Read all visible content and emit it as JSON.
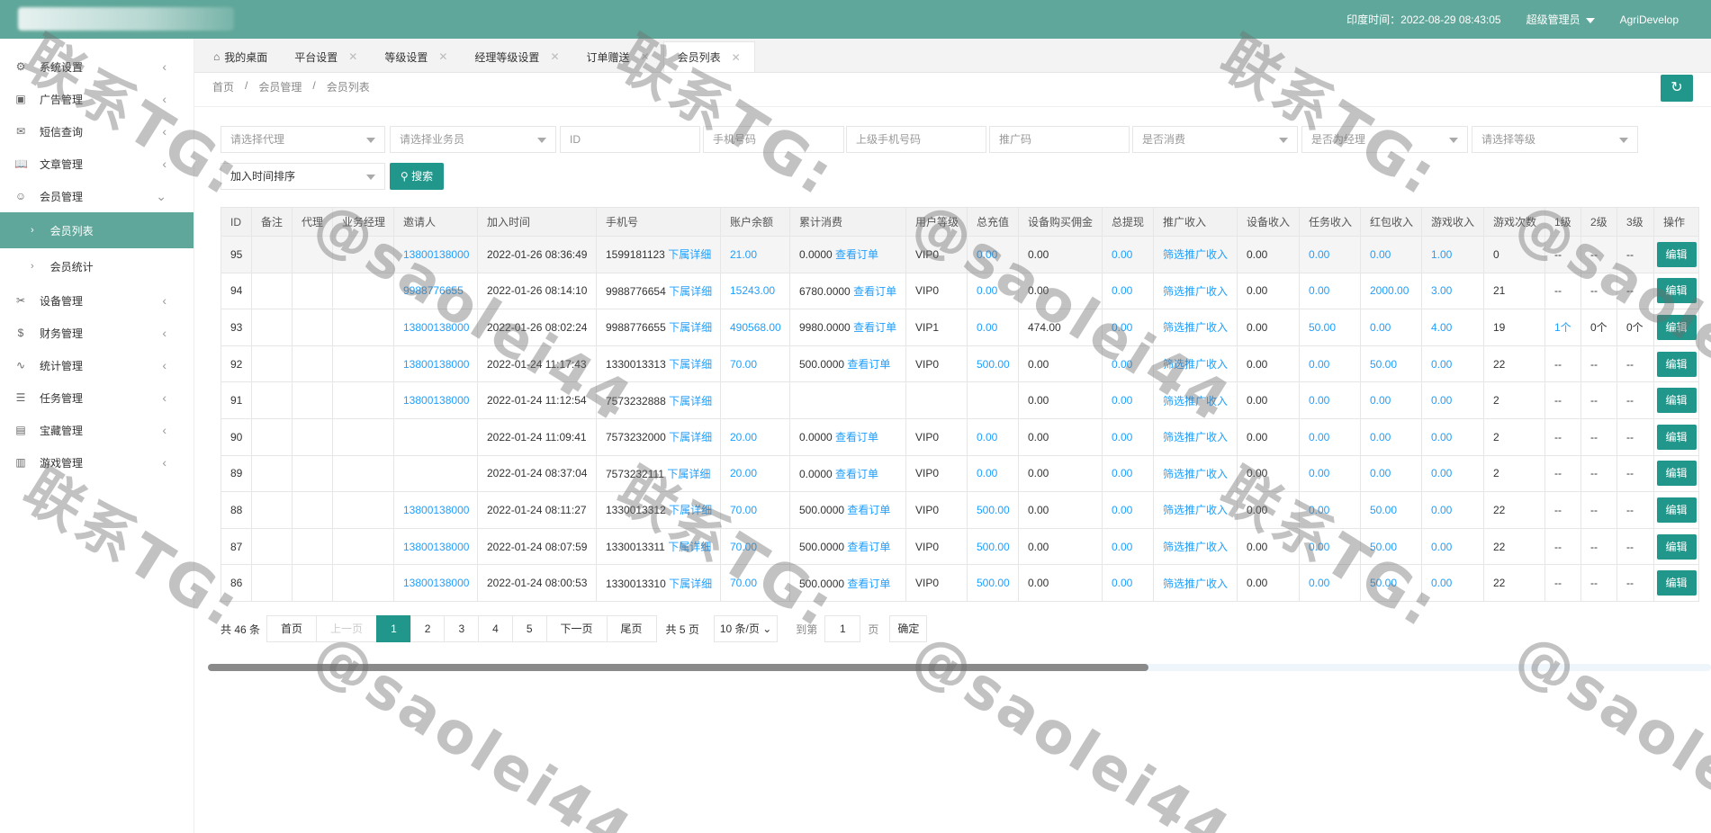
{
  "header": {
    "time_label": "印度时间：2022-08-29 08:43:05",
    "user_role": "超级管理员",
    "app_name": "AgriDevelop"
  },
  "sidebar": {
    "items": [
      {
        "label": "系统设置",
        "icon": "gear-icon",
        "glyph": "⚙"
      },
      {
        "label": "广告管理",
        "icon": "image-icon",
        "glyph": "▣"
      },
      {
        "label": "短信查询",
        "icon": "mail-icon",
        "glyph": "✉"
      },
      {
        "label": "文章管理",
        "icon": "book-icon",
        "glyph": "📖"
      },
      {
        "label": "会员管理",
        "icon": "user-icon",
        "glyph": "☺"
      }
    ],
    "sub_items": [
      {
        "label": "会员列表"
      },
      {
        "label": "会员统计"
      }
    ],
    "items2": [
      {
        "label": "设备管理",
        "icon": "tools-icon",
        "glyph": "✂"
      },
      {
        "label": "财务管理",
        "icon": "dollar-icon",
        "glyph": "$"
      },
      {
        "label": "统计管理",
        "icon": "pulse-icon",
        "glyph": "∿"
      },
      {
        "label": "任务管理",
        "icon": "sliders-icon",
        "glyph": "☰"
      },
      {
        "label": "宝藏管理",
        "icon": "gift-icon",
        "glyph": "▤"
      },
      {
        "label": "游戏管理",
        "icon": "gamepad-icon",
        "glyph": "▥"
      }
    ]
  },
  "tabs": [
    {
      "label": "我的桌面"
    },
    {
      "label": "平台设置"
    },
    {
      "label": "等级设置"
    },
    {
      "label": "经理等级设置"
    },
    {
      "label": "订单赠送"
    },
    {
      "label": "会员列表"
    }
  ],
  "breadcrumb": [
    "首页",
    "/",
    "会员管理",
    "/",
    "会员列表"
  ],
  "filters": {
    "agent": "请选择代理",
    "salesman": "请选择业务员",
    "id": "ID",
    "phone": "手机号码",
    "parent_phone": "上级手机号码",
    "promo_code": "推广码",
    "consumed": "是否消费",
    "is_manager": "是否为经理",
    "level": "请选择等级",
    "sort": "加入时间排序",
    "search_button": "搜索"
  },
  "table": {
    "headers": [
      "ID",
      "备注",
      "代理",
      "业务经理",
      "邀请人",
      "加入时间",
      "手机号",
      "账户余额",
      "累计消费",
      "用户等级",
      "总充值",
      "设备购买佣金",
      "总提现",
      "推广收入",
      "设备收入",
      "任务收入",
      "红包收入",
      "游戏收入",
      "游戏次数",
      "1级",
      "2级",
      "3级",
      "操作"
    ],
    "detail_link": "下属详细",
    "order_link": "查看订单",
    "promo_link": "筛选推广收入",
    "edit_label": "编辑",
    "rows": [
      {
        "id": "95",
        "inviter": "13800138000",
        "join": "2022-01-26 08:36:49",
        "phone": "1599181123",
        "balance": "21.00",
        "consume": "0.0000",
        "level": "VIP0",
        "recharge": "0.00",
        "commission": "0.00",
        "withdraw": "0.00",
        "device": "0.00",
        "task": "0.00",
        "redpack": "0.00",
        "game": "1.00",
        "games": "0",
        "l1": "--",
        "l2": "--",
        "l3": "--"
      },
      {
        "id": "94",
        "inviter": "9988776655",
        "join": "2022-01-26 08:14:10",
        "phone": "9988776654",
        "balance": "15243.00",
        "consume": "6780.0000",
        "level": "VIP0",
        "recharge": "0.00",
        "commission": "0.00",
        "withdraw": "0.00",
        "device": "0.00",
        "task": "0.00",
        "redpack": "2000.00",
        "game": "3.00",
        "games": "21",
        "l1": "--",
        "l2": "--",
        "l3": "--"
      },
      {
        "id": "93",
        "inviter": "13800138000",
        "join": "2022-01-26 08:02:24",
        "phone": "9988776655",
        "balance": "490568.00",
        "consume": "9980.0000",
        "level": "VIP1",
        "recharge": "0.00",
        "commission": "474.00",
        "withdraw": "0.00",
        "device": "0.00",
        "task": "50.00",
        "redpack": "0.00",
        "game": "4.00",
        "games": "19",
        "l1": "1个",
        "l2": "0个",
        "l3": "0个"
      },
      {
        "id": "92",
        "inviter": "13800138000",
        "join": "2022-01-24 11:17:43",
        "phone": "1330013313",
        "balance": "70.00",
        "consume": "500.0000",
        "level": "VIP0",
        "recharge": "500.00",
        "commission": "0.00",
        "withdraw": "0.00",
        "device": "0.00",
        "task": "0.00",
        "redpack": "50.00",
        "game": "0.00",
        "games": "22",
        "l1": "--",
        "l2": "--",
        "l3": "--"
      },
      {
        "id": "91",
        "inviter": "13800138000",
        "join": "2022-01-24 11:12:54",
        "phone": "7573232888",
        "balance": "",
        "consume": "",
        "level": "",
        "recharge": "",
        "commission": "0.00",
        "withdraw": "0.00",
        "device": "0.00",
        "task": "0.00",
        "redpack": "0.00",
        "game": "0.00",
        "games": "2",
        "l1": "--",
        "l2": "--",
        "l3": "--"
      },
      {
        "id": "90",
        "inviter": "",
        "join": "2022-01-24 11:09:41",
        "phone": "7573232000",
        "balance": "20.00",
        "consume": "0.0000",
        "level": "VIP0",
        "recharge": "0.00",
        "commission": "0.00",
        "withdraw": "0.00",
        "device": "0.00",
        "task": "0.00",
        "redpack": "0.00",
        "game": "0.00",
        "games": "2",
        "l1": "--",
        "l2": "--",
        "l3": "--"
      },
      {
        "id": "89",
        "inviter": "",
        "join": "2022-01-24 08:37:04",
        "phone": "7573232111",
        "balance": "20.00",
        "consume": "0.0000",
        "level": "VIP0",
        "recharge": "0.00",
        "commission": "0.00",
        "withdraw": "0.00",
        "device": "0.00",
        "task": "0.00",
        "redpack": "0.00",
        "game": "0.00",
        "games": "2",
        "l1": "--",
        "l2": "--",
        "l3": "--"
      },
      {
        "id": "88",
        "inviter": "13800138000",
        "join": "2022-01-24 08:11:27",
        "phone": "1330013312",
        "balance": "70.00",
        "consume": "500.0000",
        "level": "VIP0",
        "recharge": "500.00",
        "commission": "0.00",
        "withdraw": "0.00",
        "device": "0.00",
        "task": "0.00",
        "redpack": "50.00",
        "game": "0.00",
        "games": "22",
        "l1": "--",
        "l2": "--",
        "l3": "--"
      },
      {
        "id": "87",
        "inviter": "13800138000",
        "join": "2022-01-24 08:07:59",
        "phone": "1330013311",
        "balance": "70.00",
        "consume": "500.0000",
        "level": "VIP0",
        "recharge": "500.00",
        "commission": "0.00",
        "withdraw": "0.00",
        "device": "0.00",
        "task": "0.00",
        "redpack": "50.00",
        "game": "0.00",
        "games": "22",
        "l1": "--",
        "l2": "--",
        "l3": "--"
      },
      {
        "id": "86",
        "inviter": "13800138000",
        "join": "2022-01-24 08:00:53",
        "phone": "1330013310",
        "balance": "70.00",
        "consume": "500.0000",
        "level": "VIP0",
        "recharge": "500.00",
        "commission": "0.00",
        "withdraw": "0.00",
        "device": "0.00",
        "task": "0.00",
        "redpack": "50.00",
        "game": "0.00",
        "games": "22",
        "l1": "--",
        "l2": "--",
        "l3": "--"
      }
    ]
  },
  "pagination": {
    "total": "共 46 条",
    "first": "首页",
    "prev": "上一页",
    "pages": [
      "1",
      "2",
      "3",
      "4",
      "5"
    ],
    "current": "1",
    "next": "下一页",
    "last": "尾页",
    "total_pages": "共 5 页",
    "page_size": "10 条/页",
    "goto": "到第",
    "goto_value": "1",
    "page_unit": "页",
    "confirm": "确定"
  },
  "watermark": {
    "line1": "联系TG:",
    "line2": "@saolei44"
  },
  "colors": {
    "header": "#5fa79a",
    "primary": "#21968a",
    "link": "#1e9fff"
  }
}
